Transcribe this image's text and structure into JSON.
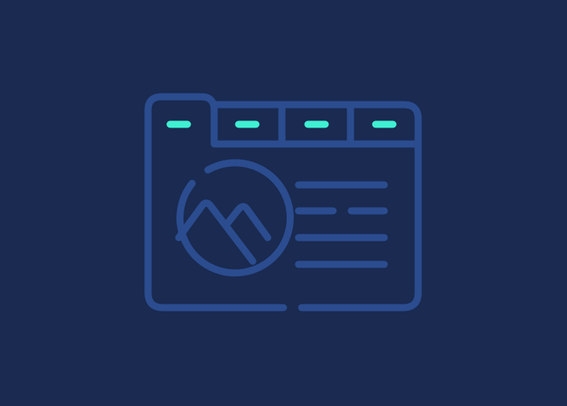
{
  "illustration": {
    "subject": "browser-window-with-tabs-and-image-placeholder",
    "icon_name": "web-page-icon",
    "tab_count": 4,
    "text_line_count": 5
  },
  "colors": {
    "background": "#1a2a50",
    "outline": "#2b4c8f",
    "accent": "#3ff0d2"
  }
}
